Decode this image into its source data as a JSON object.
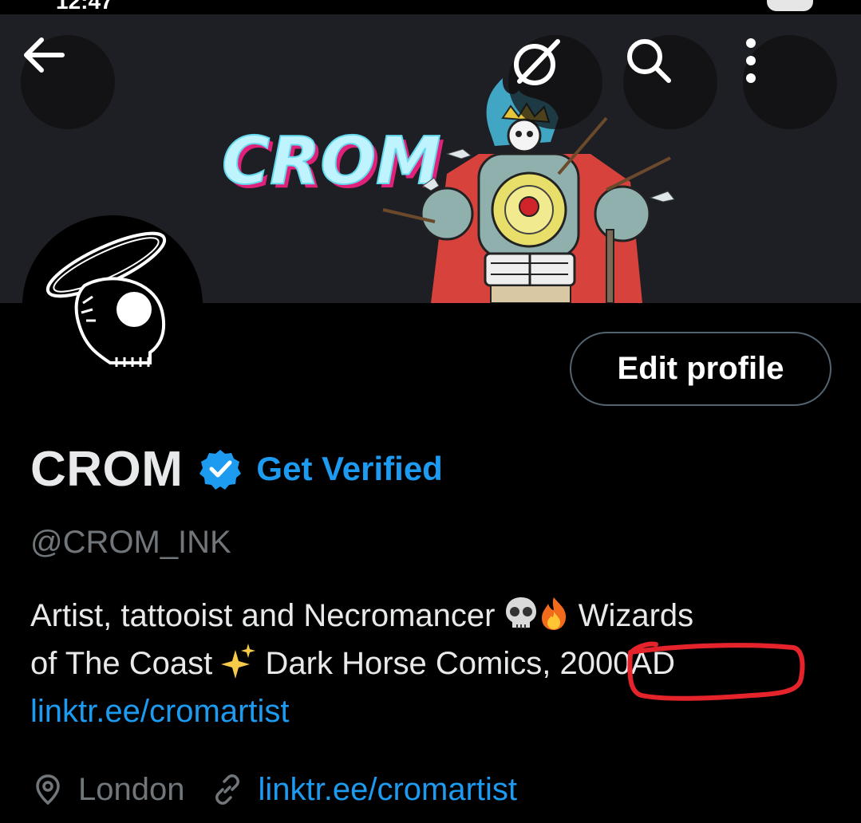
{
  "status_bar": {
    "time": "12:47"
  },
  "header": {
    "banner_title": "CROM",
    "buttons": [
      "back-arrow-icon",
      "grok-icon",
      "search-icon",
      "more-vertical-icon"
    ]
  },
  "profile": {
    "name": "CROM",
    "get_verified_label": "Get Verified",
    "handle": "@CROM_INK",
    "edit_profile_label": "Edit profile",
    "bio": {
      "line1_text": "Artist, tattooist and Necromancer ",
      "line1_after": " Wizards",
      "line2_text": "of The Coast ",
      "line2_after": " Dark Horse Comics, ",
      "highlight": "2000AD",
      "link": "linktr.ee/cromartist"
    },
    "location": "London",
    "website": "linktr.ee/cromartist"
  },
  "colors": {
    "accent": "#1d9bf0",
    "secondary_text": "#71767b",
    "annotation": "#e5232a",
    "banner_bg": "#1e1f24"
  }
}
